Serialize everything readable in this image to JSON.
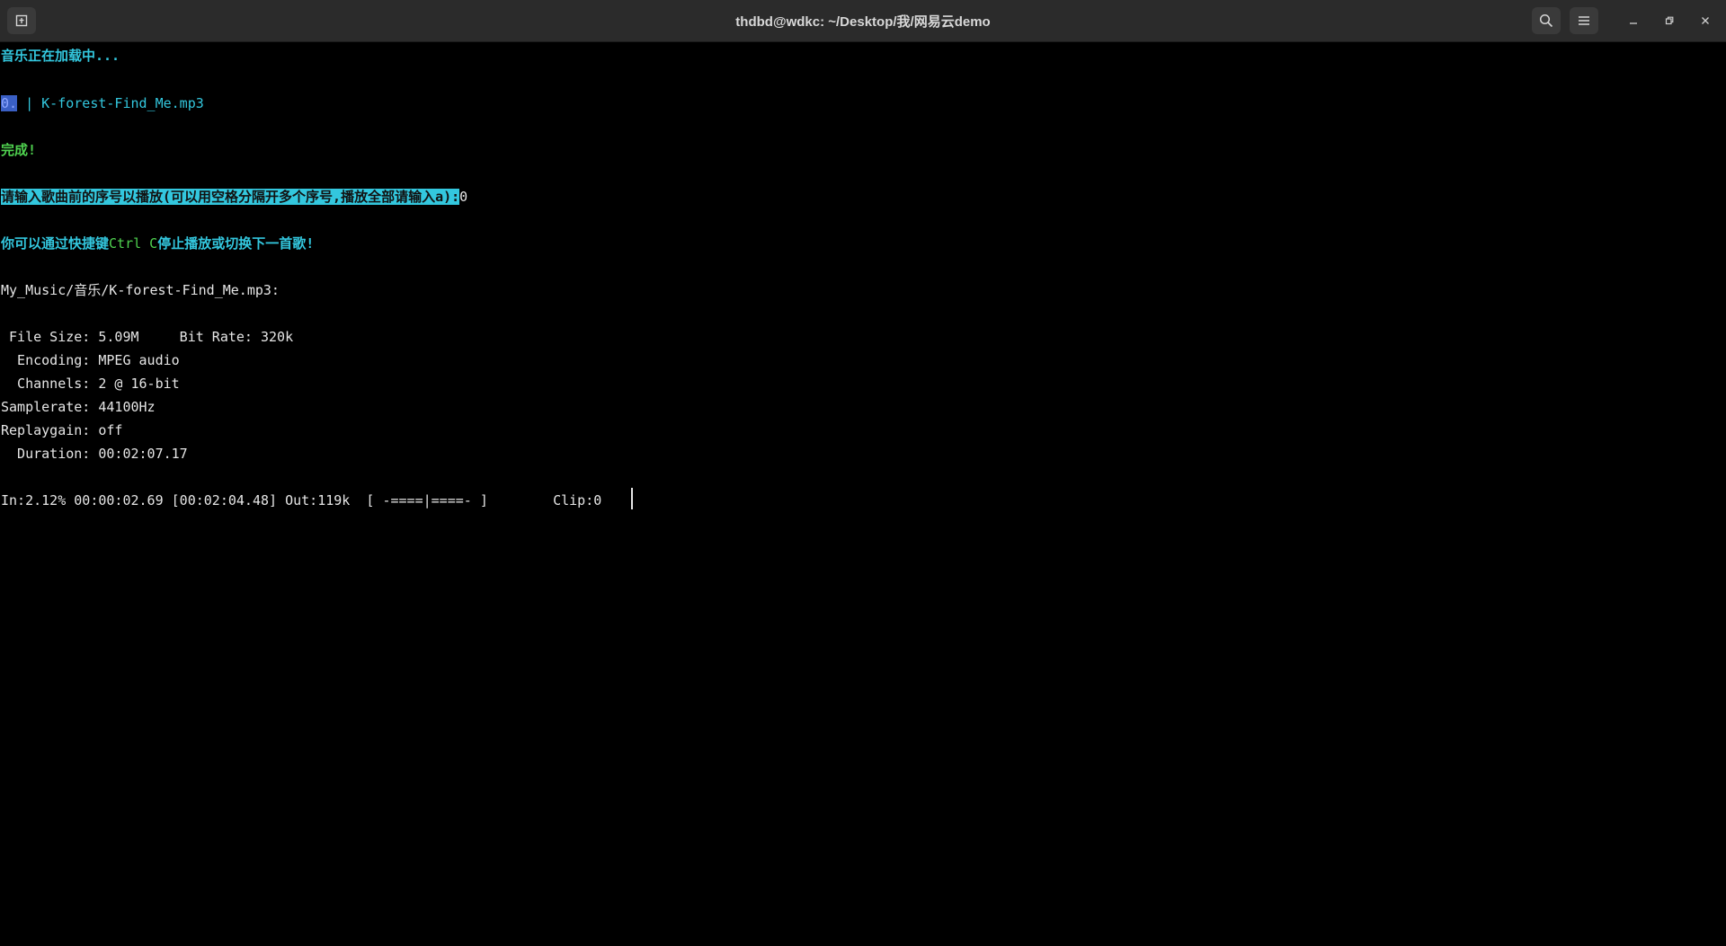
{
  "window": {
    "title": "thdbd@wdkc: ~/Desktop/我/网易云demo"
  },
  "colors": {
    "background": "#000000",
    "titlebar": "#2b2b2b",
    "cyan_text": "#33c7de",
    "green_text": "#4fd14f",
    "default_text": "#e6e6e6",
    "selection_bg": "#33c7de"
  },
  "icons": {
    "new_tab": "new-tab-icon",
    "search": "search-icon",
    "menu": "hamburger-menu-icon",
    "minimize": "minimize-icon",
    "maximize": "restore-icon",
    "close": "close-icon"
  },
  "terminal": {
    "loading": "音乐正在加载中...",
    "song_index": "0.",
    "song_separator": " | ",
    "song_name": "K-forest-Find_Me.mp3",
    "done": "完成!",
    "prompt": "请输入歌曲前的序号以播放(可以用空格分隔开多个序号,播放全部请输入a):",
    "user_input": "0",
    "hint_prefix": "你可以通过快捷键",
    "hint_key": "Ctrl C",
    "hint_suffix": "停止播放或切换下一首歌!",
    "file_path": "My_Music/音乐/K-forest-Find_Me.mp3:",
    "file_size_line": " File Size: 5.09M     Bit Rate: 320k",
    "encoding_line": "  Encoding: MPEG audio",
    "channels_line": "  Channels: 2 @ 16-bit",
    "samplerate_line": "Samplerate: 44100Hz",
    "replaygain_line": "Replaygain: off",
    "duration_line": "  Duration: 00:02:07.17",
    "progress_line": "In:2.12% 00:00:02.69 [00:02:04.48] Out:119k  [ -====|====- ]        Clip:0"
  }
}
